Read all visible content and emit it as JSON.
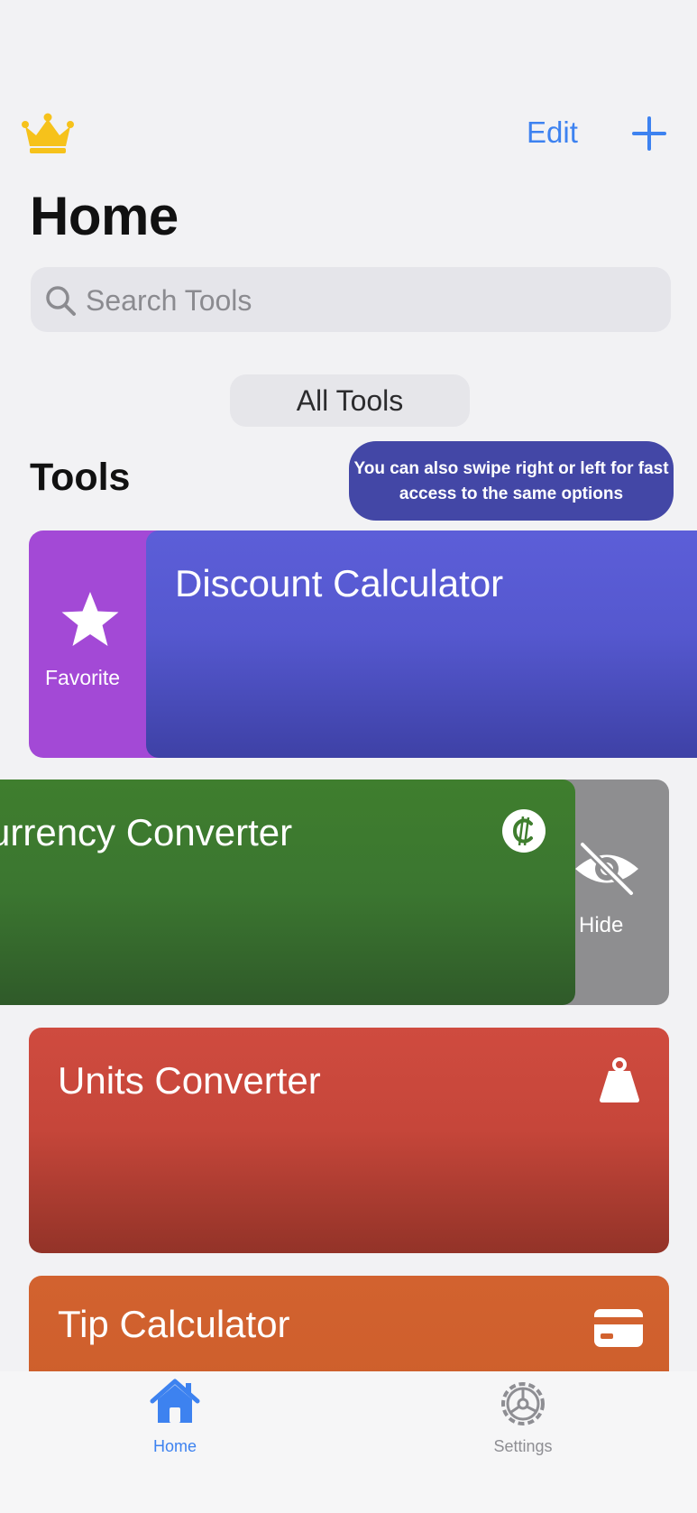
{
  "header": {
    "premium_icon": "crown-icon",
    "edit_label": "Edit",
    "add_icon": "plus-icon",
    "title": "Home"
  },
  "search": {
    "placeholder": "Search Tools",
    "icon": "magnifier-icon"
  },
  "filter": {
    "selected": "All Tools"
  },
  "tools_section": {
    "heading": "Tools",
    "tooltip": "You can also swipe right or left for fast access to the same options"
  },
  "cards": [
    {
      "name": "Discount Calculator",
      "color": "#5c5ed8",
      "swipe_action": {
        "label": "Favorite",
        "icon": "star-icon",
        "color": "#a349d6"
      }
    },
    {
      "name": "Currency Converter",
      "visible_name": "urrency Converter",
      "icon": "currency-coin-icon",
      "color": "#3f7e2e",
      "swipe_action": {
        "label": "Hide",
        "icon": "eye-slash-icon",
        "color": "#8e8e90"
      }
    },
    {
      "name": "Units Converter",
      "icon": "weight-icon",
      "color": "#cf4b3f"
    },
    {
      "name": "Tip Calculator",
      "icon": "credit-card-icon",
      "color": "#d2622f"
    }
  ],
  "tabbar": {
    "home_label": "Home",
    "settings_label": "Settings",
    "active": "Home",
    "accent": "#3d82f0"
  }
}
